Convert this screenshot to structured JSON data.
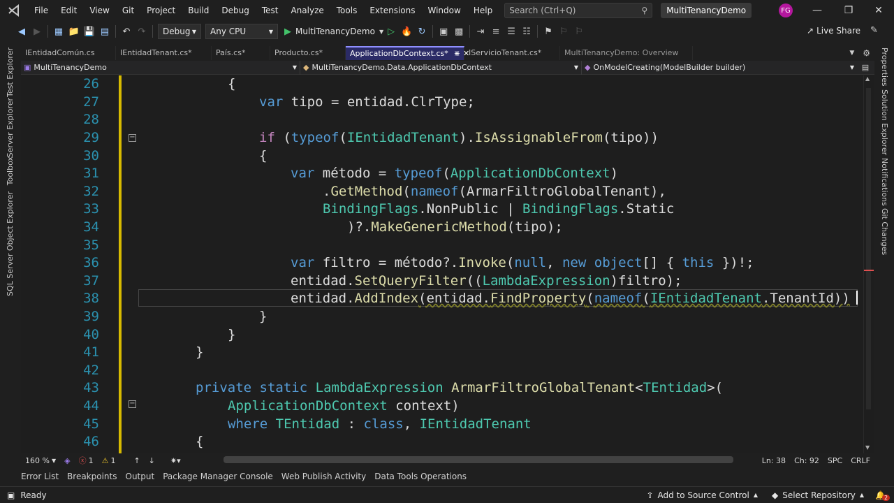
{
  "menu": {
    "items": [
      "File",
      "Edit",
      "View",
      "Git",
      "Project",
      "Build",
      "Debug",
      "Test",
      "Analyze",
      "Tools",
      "Extensions",
      "Window",
      "Help"
    ],
    "search_placeholder": "Search (Ctrl+Q)",
    "solution": "MultiTenancyDemo",
    "avatar": "FG"
  },
  "toolbar": {
    "config": "Debug",
    "platform": "Any CPU",
    "run_target": "MultiTenancyDemo",
    "live_share": "Live Share"
  },
  "left_panels": [
    "Test Explorer",
    "Server Explorer",
    "Toolbox",
    "SQL Server Object Explorer"
  ],
  "right_panels": [
    "Properties",
    "Solution Explorer",
    "Notifications",
    "Git Changes"
  ],
  "tabs": [
    {
      "label": "IEntidadComún.cs"
    },
    {
      "label": "IEntidadTenant.cs*"
    },
    {
      "label": "País.cs*"
    },
    {
      "label": "Producto.cs*"
    },
    {
      "label": "ApplicationDbContext.cs*",
      "active": true
    },
    {
      "label": "IServicioTenant.cs*"
    },
    {
      "label": "MultiTenancyDemo: Overview",
      "preview": true
    }
  ],
  "navbar": {
    "project": "MultiTenancyDemo",
    "type": "MultiTenancyDemo.Data.ApplicationDbContext",
    "member": "OnModelCreating(ModelBuilder builder)"
  },
  "code": {
    "line_numbers": [
      "26",
      "27",
      "28",
      "29",
      "30",
      "31",
      "32",
      "33",
      "34",
      "35",
      "36",
      "37",
      "38",
      "39",
      "40",
      "41",
      "42",
      "43",
      "44",
      "45",
      "46"
    ],
    "l26": "{",
    "l27_var": "var",
    "l27_rest": " tipo = entidad.ClrType;",
    "l29_if": "if",
    "l29_a": " (",
    "l29_typeof": "typeof",
    "l29_b": "(",
    "l29_type": "IEntidadTenant",
    "l29_c": ").",
    "l29_method": "IsAssignableFrom",
    "l29_d": "(tipo))",
    "l30": "{",
    "l31_var": "var",
    "l31_a": " método = ",
    "l31_typeof": "typeof",
    "l31_b": "(",
    "l31_type": "ApplicationDbContext",
    "l31_c": ")",
    "l32_a": ".",
    "l32_method": "GetMethod",
    "l32_b": "(",
    "l32_nameof": "nameof",
    "l32_c": "(ArmarFiltroGlobalTenant),",
    "l33_type1": "BindingFlags",
    "l33_a": ".NonPublic | ",
    "l33_type2": "BindingFlags",
    "l33_b": ".Static",
    "l34_a": ")?.",
    "l34_method": "MakeGenericMethod",
    "l34_b": "(tipo);",
    "l36_var": "var",
    "l36_a": " filtro = método?.",
    "l36_method": "Invoke",
    "l36_b": "(",
    "l36_null": "null",
    "l36_c": ", ",
    "l36_new": "new",
    "l36_d": " ",
    "l36_object": "object",
    "l36_e": "[] { ",
    "l36_this": "this",
    "l36_f": " })!;",
    "l37_a": "entidad.",
    "l37_method": "SetQueryFilter",
    "l37_b": "((",
    "l37_type": "LambdaExpression",
    "l37_c": ")filtro);",
    "l38_a": "entidad.",
    "l38_method": "AddIndex",
    "l38_b": "(entidad.",
    "l38_method2": "FindProperty",
    "l38_c": "(",
    "l38_nameof": "nameof",
    "l38_d": "(",
    "l38_type": "IEntidadTenant",
    "l38_e": ".TenantId))",
    "l39": "}",
    "l40": "}",
    "l41": "}",
    "l43_private": "private",
    "l43_static": "static",
    "l43_type": "LambdaExpression",
    "l43_method": "ArmarFiltroGlobalTenant",
    "l43_a": "<",
    "l43_generic": "TEntidad",
    "l43_b": ">(",
    "l44_type": "ApplicationDbContext",
    "l44_a": " context)",
    "l45_where": "where",
    "l45_generic": "TEntidad",
    "l45_a": " : ",
    "l45_class": "class",
    "l45_b": ", ",
    "l45_type": "IEntidadTenant",
    "l46": "{"
  },
  "editor_status": {
    "zoom": "160 %",
    "errors": "1",
    "warnings": "1",
    "line": "Ln: 38",
    "col": "Ch: 92",
    "ins": "SPC",
    "eol": "CRLF"
  },
  "tool_windows": [
    "Error List",
    "Breakpoints",
    "Output",
    "Package Manager Console",
    "Web Publish Activity",
    "Data Tools Operations"
  ],
  "statusbar": {
    "ready": "Ready",
    "source_control": "Add to Source Control",
    "repository": "Select Repository",
    "notif_count": "2"
  },
  "colors": {
    "accent": "#8f8fff",
    "active_tab": "#2b2b66",
    "keyword": "#569cd6",
    "type": "#4ec9b0",
    "method": "#dcdcaa",
    "line_number": "#2b91af",
    "change_bar": "#d7ba00"
  }
}
